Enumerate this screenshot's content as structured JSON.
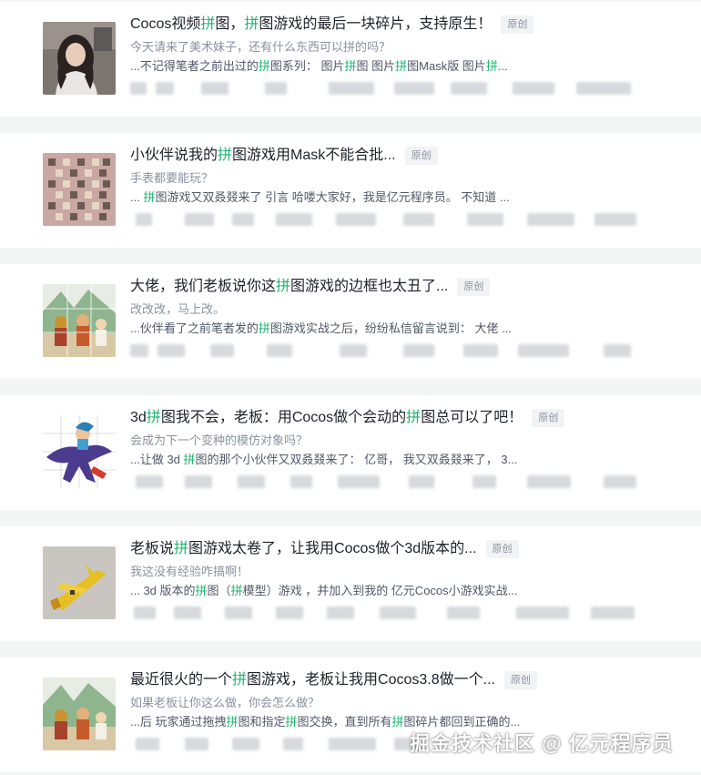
{
  "articles": [
    {
      "title_parts": [
        "Cocos视频",
        "拼",
        "图，",
        "拼",
        "图游戏的最后一块碎片，支持原生！"
      ],
      "badge": "原创",
      "subtitle": "今天请来了美术妹子，还有什么东西可以拼的吗？",
      "snippet_parts": [
        "...不记得笔者之前出过的",
        "拼",
        "图系列： 图片",
        "拼",
        "图 图片",
        "拼",
        "图Mask版 图片",
        "拼",
        "..."
      ],
      "thumb_icon": "woman-photo-icon"
    },
    {
      "title_parts": [
        "小伙伴说我的",
        "拼",
        "图游戏用Mask不能合批..."
      ],
      "badge": "原创",
      "subtitle": "手表都要能玩？",
      "snippet_parts": [
        "... ",
        "拼",
        "图游戏又双叒叕来了 引言 哈喽大家好，我是亿元程序员。 不知道 ..."
      ],
      "thumb_icon": "puzzle-grid-icon"
    },
    {
      "title_parts": [
        "大佬，我们老板说你这",
        "拼",
        "图游戏的边框也太丑了..."
      ],
      "badge": "原创",
      "subtitle": "改改改，马上改。",
      "snippet_parts": [
        "...伙伴看了之前笔者发的",
        "拼",
        "图游戏实战之后，纷纷私信留言说到： 大佬 ..."
      ],
      "thumb_icon": "journey-west-illustration-icon"
    },
    {
      "title_parts": [
        "3d",
        "拼",
        "图我不会，老板：用Cocos做个会动的",
        "拼",
        "图总可以了吧！"
      ],
      "badge": "原创",
      "subtitle": "会成为下一个变种的模仿对象吗？",
      "snippet_parts": [
        "...让做 3d ",
        "拼",
        "图的那个小伙伴又双叒叕来了： 亿哥， 我又双叒叕来了， 3..."
      ],
      "thumb_icon": "dragon-rider-icon"
    },
    {
      "title_parts": [
        "老板说",
        "拼",
        "图游戏太卷了，让我用Cocos做个3d版本的..."
      ],
      "badge": "原创",
      "subtitle": "我这没有经验咋搞啊！",
      "snippet_parts": [
        "... 3d 版本的",
        "拼",
        "图（",
        "拼",
        "模型）游戏 ，并加入到我的 亿元Cocos小游戏实战..."
      ],
      "thumb_icon": "yellow-airplane-icon"
    },
    {
      "title_parts": [
        "最近很火的一个",
        "拼",
        "图游戏，老板让我用Cocos3.8做一个..."
      ],
      "badge": "原创",
      "subtitle": "如果老板让你这么做，你会怎么做？",
      "snippet_parts": [
        "...后 玩家通过拖拽",
        "拼",
        "图和指定",
        "拼",
        "图交换，直到所有",
        "拼",
        "图碎片都回到正确的..."
      ],
      "thumb_icon": "journey-west-illustration-icon"
    }
  ],
  "watermark": "掘金技术社区 @ 亿元程序员",
  "colors": {
    "highlight": "#1fb56f",
    "title": "#1d2129",
    "muted": "#8a919f",
    "snippet": "#515767",
    "page_bg": "#f4f5f5"
  }
}
